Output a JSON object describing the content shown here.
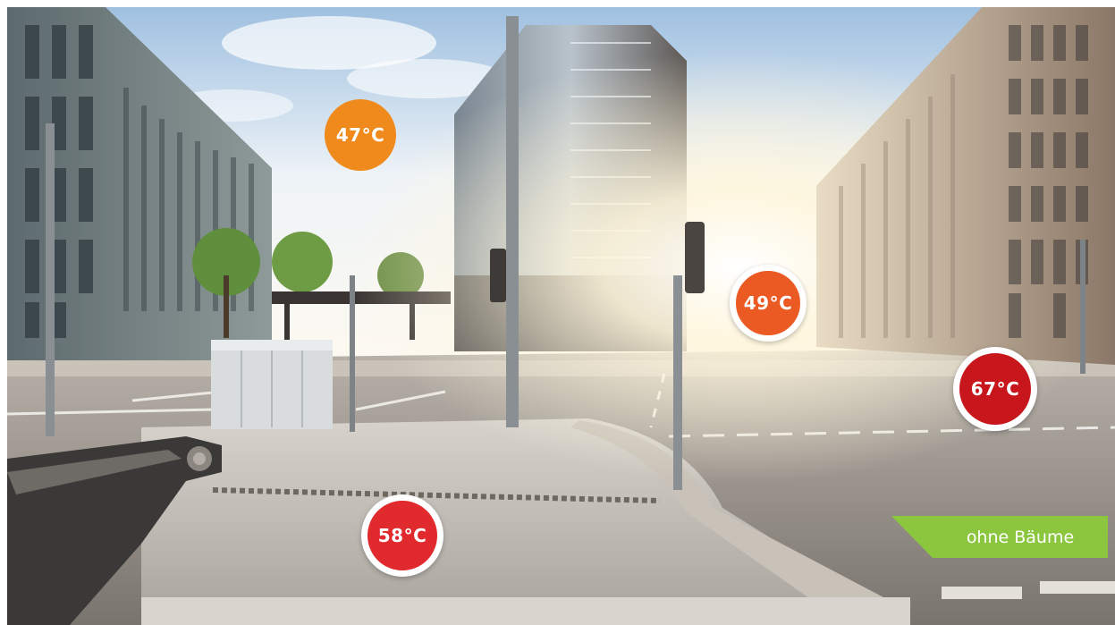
{
  "image": {
    "label": "ohne Bäume",
    "label_color": "#8cc63f",
    "temperatures": [
      {
        "value": "47°C",
        "color": "#f08a1c"
      },
      {
        "value": "49°C",
        "color": "#ec5a24"
      },
      {
        "value": "67°C",
        "color": "#c8161d"
      },
      {
        "value": "58°C",
        "color": "#e02a2e"
      }
    ]
  }
}
